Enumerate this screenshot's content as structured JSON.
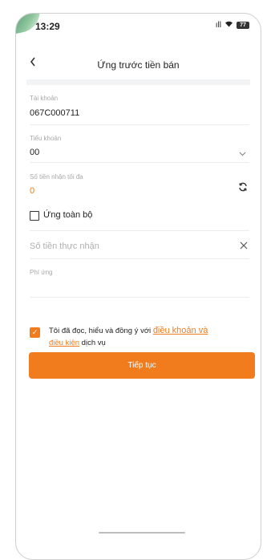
{
  "status_bar": {
    "time": "13:29",
    "signal": "ıll",
    "wifi": "wifi-icon",
    "battery": "77"
  },
  "header": {
    "back_icon": "chevron-left-icon",
    "title": "Ứng trước tiền bán"
  },
  "form": {
    "account": {
      "label": "Tài khoản",
      "value": "067C000711"
    },
    "sub_account": {
      "label": "Tiểu khoản",
      "value": "00",
      "icon": "chevron-down-icon"
    },
    "max_receive": {
      "label": "Số tiền nhận tối đa",
      "value": "0",
      "icon": "refresh-icon"
    },
    "advance_all": {
      "label": "Ứng toàn bộ",
      "checked": false
    },
    "actual_receive": {
      "placeholder": "Số tiền thực nhận",
      "icon": "close-icon"
    },
    "fee": {
      "label": "Phí ứng"
    }
  },
  "terms": {
    "checked": true,
    "prefix": "Tôi đã đọc, hiểu và đồng ý với ",
    "link_part1": "điều khoản và",
    "link_part2": "điều kiện",
    "suffix": " dịch vụ"
  },
  "actions": {
    "continue_label": "Tiếp tục"
  },
  "colors": {
    "accent": "#f07c1e",
    "value_orange": "#f07c1e"
  }
}
